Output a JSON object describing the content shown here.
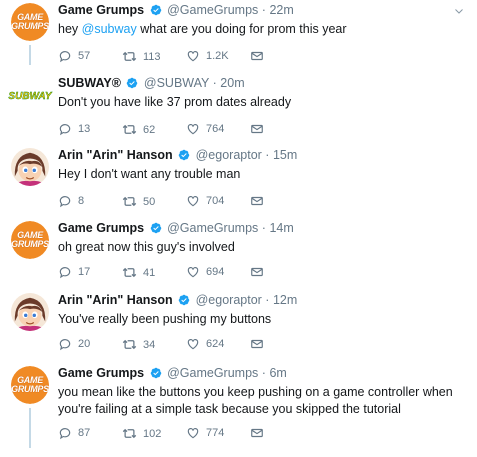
{
  "tweets": [
    {
      "name": "Game Grumps",
      "verified": true,
      "handle": "@GameGrumps",
      "sep": "·",
      "time": "22m",
      "text_before": "hey ",
      "mention": "@subway",
      "text_after": " what are you doing for prom this year",
      "replies": "57",
      "retweets": "113",
      "likes": "1.2K",
      "avatar": "gamegrumps-logo"
    },
    {
      "name": "SUBWAY®",
      "verified": true,
      "handle": "@SUBWAY",
      "sep": "·",
      "time": "20m",
      "text": "Don't you have like 37 prom dates already",
      "replies": "13",
      "retweets": "62",
      "likes": "764",
      "avatar": "subway-logo"
    },
    {
      "name": "Arin \"Arin\" Hanson",
      "verified": true,
      "handle": "@egoraptor",
      "sep": "·",
      "time": "15m",
      "text": "Hey I don't want any trouble man",
      "replies": "8",
      "retweets": "50",
      "likes": "704",
      "avatar": "arin-avatar"
    },
    {
      "name": "Game Grumps",
      "verified": true,
      "handle": "@GameGrumps",
      "sep": "·",
      "time": "14m",
      "text": "oh great now this guy's involved",
      "replies": "17",
      "retweets": "41",
      "likes": "694",
      "avatar": "gamegrumps-logo"
    },
    {
      "name": "Arin \"Arin\" Hanson",
      "verified": true,
      "handle": "@egoraptor",
      "sep": "·",
      "time": "12m",
      "text": "You've really been pushing my buttons",
      "replies": "20",
      "retweets": "34",
      "likes": "624",
      "avatar": "arin-avatar"
    },
    {
      "name": "Game Grumps",
      "verified": true,
      "handle": "@GameGrumps",
      "sep": "·",
      "time": "6m",
      "text_line1": "you mean like the buttons you keep pushing on a game controller when",
      "text_line2": "you're failing at a simple task because you skipped the tutorial",
      "replies": "87",
      "retweets": "102",
      "likes": "774",
      "avatar": "gamegrumps-logo"
    }
  ],
  "logos": {
    "gamegrumps_line1": "GAME",
    "gamegrumps_line2": "GRUMPS",
    "subway": "SUBWAY"
  },
  "colors": {
    "accent": "#1da1f2",
    "muted": "#657786",
    "thread_line": "#c4d9e6",
    "gamegrumps_orange": "#f08a24",
    "subway_green": "#008c15",
    "subway_yellow": "#ffc20e"
  }
}
